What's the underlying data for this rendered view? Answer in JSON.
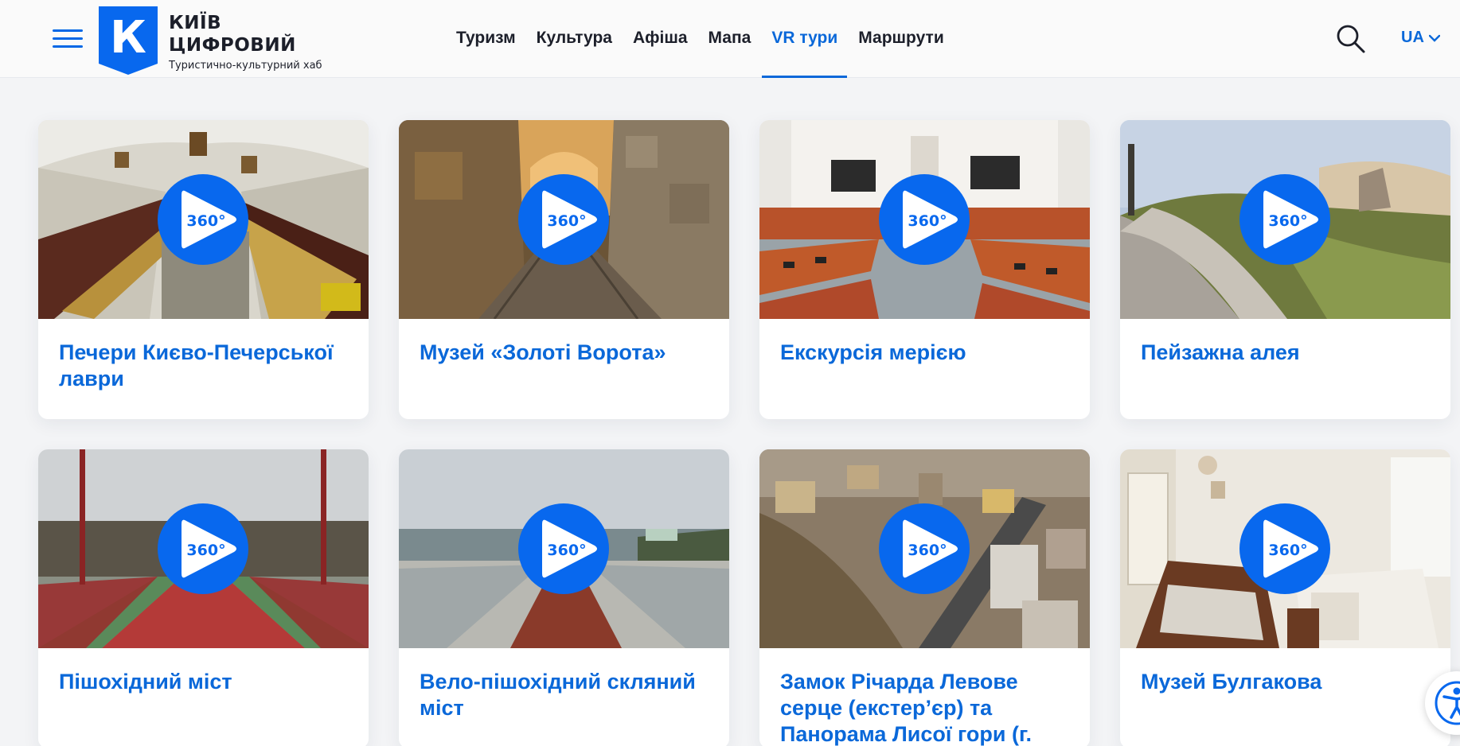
{
  "header": {
    "logo_title": "КИЇВ\nЦИФРОВИЙ",
    "logo_letter": "К",
    "logo_subtitle": "Туристично-культурний хаб",
    "nav": [
      {
        "label": "Туризм"
      },
      {
        "label": "Культура"
      },
      {
        "label": "Афіша"
      },
      {
        "label": "Мапа"
      },
      {
        "label": "VR тури",
        "active": true
      },
      {
        "label": "Маршрути"
      }
    ],
    "language": "UA"
  },
  "colors": {
    "brand_blue": "#0a68d9",
    "play_blue": "#0868ee"
  },
  "play_badge": "360°",
  "cards": [
    {
      "title": "Печери Києво-Печерської лаври"
    },
    {
      "title": "Музей «Золоті Ворота»"
    },
    {
      "title": "Екскурсія мерією"
    },
    {
      "title": "Пейзажна алея"
    },
    {
      "title": "Пішохідний міст"
    },
    {
      "title": "Вело-пішохідний скляний міст"
    },
    {
      "title": "Замок Річарда Левове серце (екстер’єр) та Панорама Лисої гори (г."
    },
    {
      "title": "Музей Булгакова"
    }
  ]
}
